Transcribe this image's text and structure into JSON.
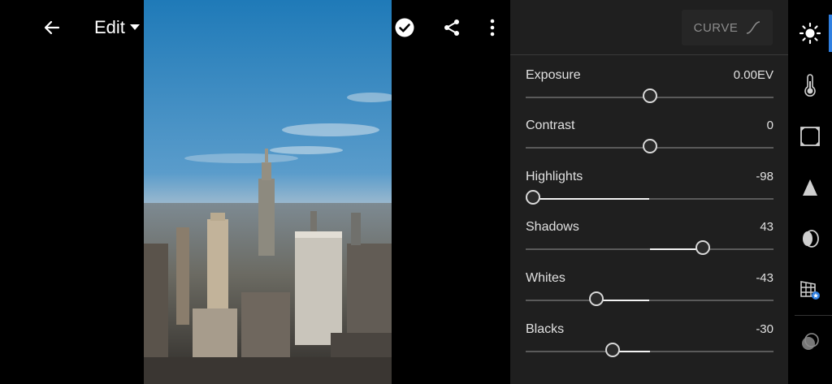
{
  "toolbar": {
    "edit_label": "Edit"
  },
  "panel": {
    "curve_label": "CURVE",
    "sliders": [
      {
        "name": "Exposure",
        "value": "0.00EV",
        "position": 0.5,
        "min": -5,
        "max": 5,
        "current": 0
      },
      {
        "name": "Contrast",
        "value": "0",
        "position": 0.5,
        "min": -100,
        "max": 100,
        "current": 0
      },
      {
        "name": "Highlights",
        "value": "-98",
        "position": 0.01,
        "min": -100,
        "max": 100,
        "current": -98
      },
      {
        "name": "Shadows",
        "value": "43",
        "position": 0.715,
        "min": -100,
        "max": 100,
        "current": 43
      },
      {
        "name": "Whites",
        "value": "-43",
        "position": 0.285,
        "min": -100,
        "max": 100,
        "current": -43
      },
      {
        "name": "Blacks",
        "value": "-30",
        "position": 0.35,
        "min": -100,
        "max": 100,
        "current": -30
      }
    ]
  },
  "rail": {
    "items": [
      "light-icon",
      "color-icon",
      "effects-icon",
      "detail-icon",
      "optics-icon",
      "geometry-icon",
      "mix-icon"
    ],
    "active": "light-icon"
  },
  "colors": {
    "accent": "#2f7fe0",
    "panel_bg": "#1f1f1f",
    "track": "#5a5a5a",
    "track_fill": "#f2f2f2"
  }
}
